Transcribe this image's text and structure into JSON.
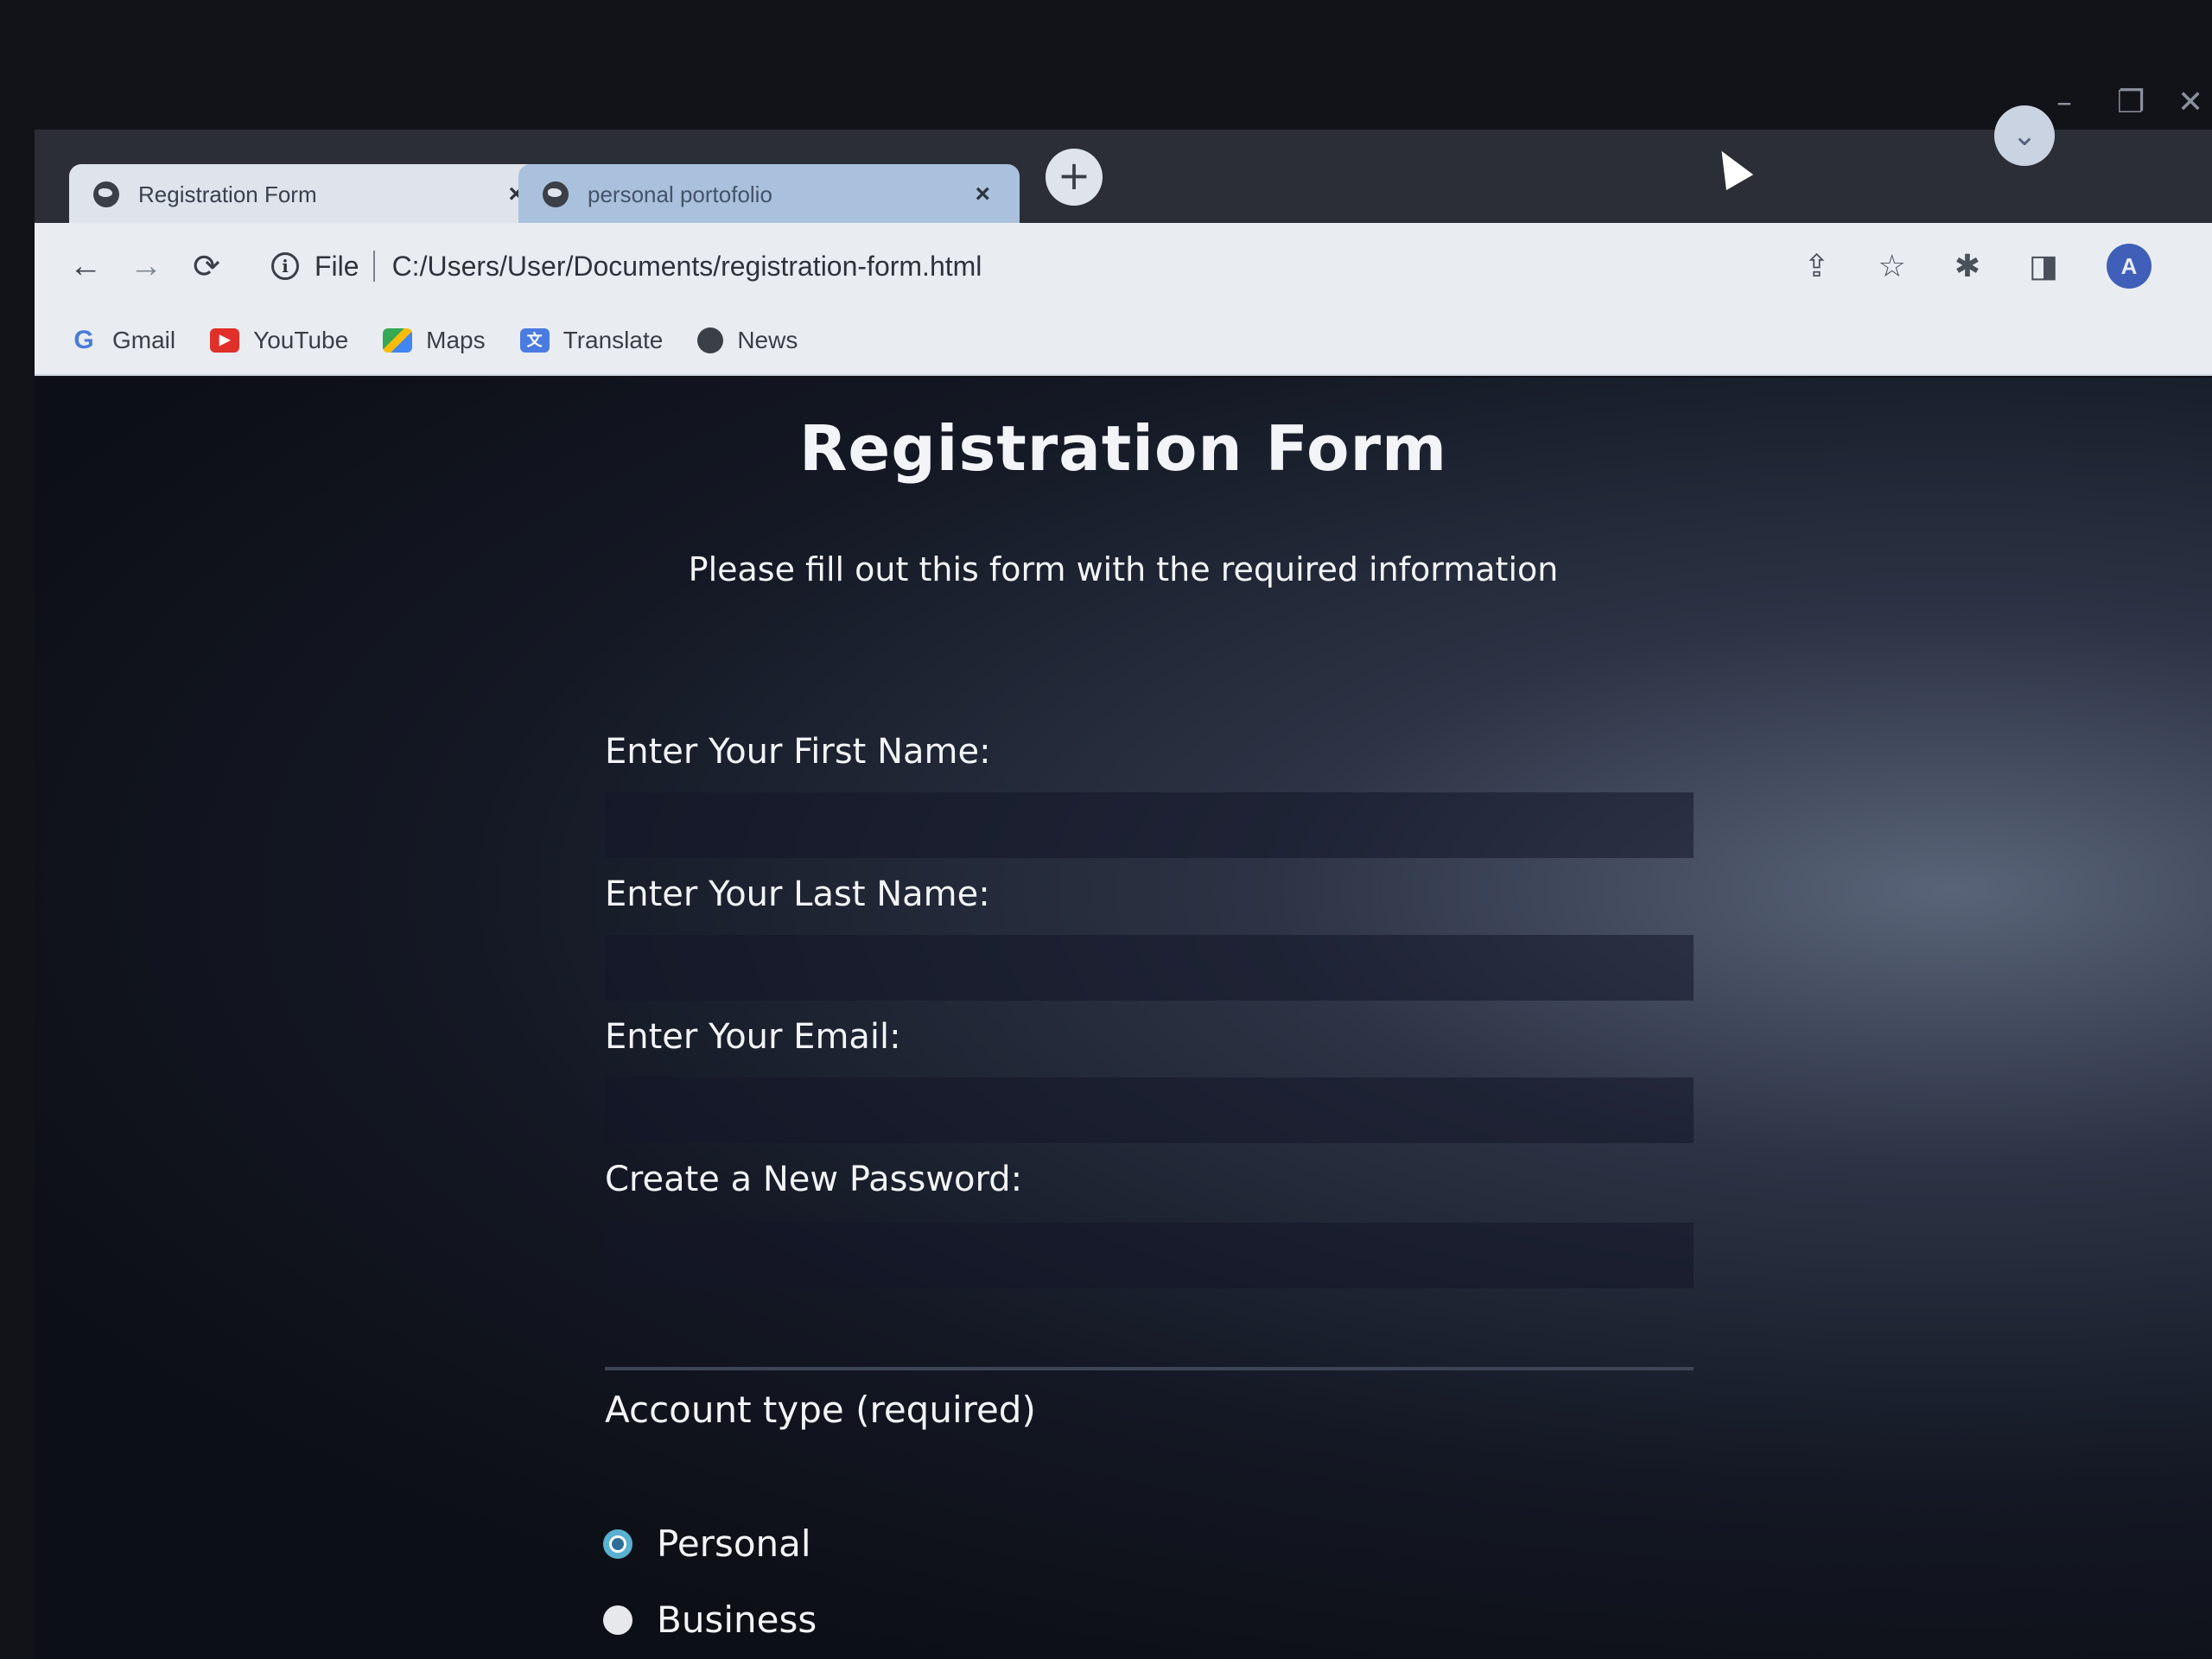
{
  "browser": {
    "tabs": [
      {
        "title": "Registration Form",
        "active": true
      },
      {
        "title": "personal portofolio",
        "active": false
      }
    ],
    "new_tab_symbol": "+",
    "close_symbol": "×",
    "tab_search_symbol": "⌄",
    "window_controls": {
      "minimize": "–",
      "maximize": "❐",
      "close": "✕"
    },
    "toolbar": {
      "back_symbol": "←",
      "forward_symbol": "→",
      "reload_symbol": "⟳",
      "info_symbol": "i",
      "scheme": "File",
      "url": "C:/Users/User/Documents/registration-form.html",
      "share_icon": "⇪",
      "star_icon": "☆",
      "extensions_icon": "✱",
      "sidepanel_icon": "◨",
      "avatar_letter": "A"
    },
    "bookmarks": [
      {
        "label": "Gmail",
        "icon": "gmail-icon",
        "glyph": "G"
      },
      {
        "label": "YouTube",
        "icon": "youtube-icon",
        "glyph": "▶"
      },
      {
        "label": "Maps",
        "icon": "maps-icon",
        "glyph": ""
      },
      {
        "label": "Translate",
        "icon": "translate-icon",
        "glyph": "文"
      },
      {
        "label": "News",
        "icon": "news-icon",
        "glyph": ""
      }
    ]
  },
  "page": {
    "title": "Registration Form",
    "subtitle": "Please fill out this form with the required information",
    "fields": [
      {
        "label": "Enter Your First Name:",
        "value": ""
      },
      {
        "label": "Enter Your Last Name:",
        "value": ""
      },
      {
        "label": "Enter Your Email:",
        "value": ""
      },
      {
        "label": "Create a New Password:",
        "value": ""
      }
    ],
    "account_type": {
      "label": "Account type (required)",
      "options": [
        {
          "label": "Personal",
          "checked": true
        },
        {
          "label": "Business",
          "checked": false
        }
      ]
    }
  },
  "colors": {
    "radio_accent": "#5ab0d0",
    "page_background": "#0d0f16",
    "toolbar_background": "#e9edf2"
  }
}
